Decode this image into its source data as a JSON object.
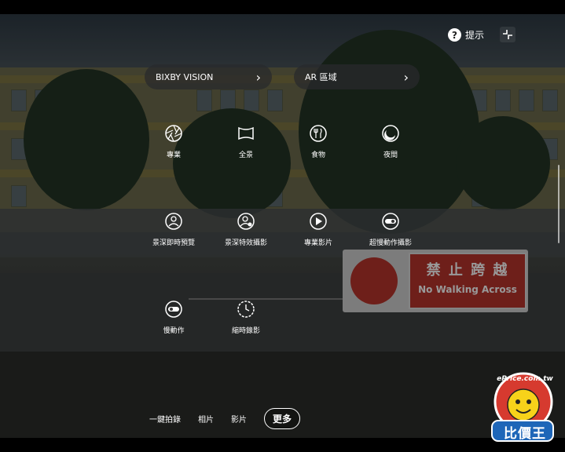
{
  "header": {
    "help_label": "提示"
  },
  "pills": [
    {
      "label": "BIXBY VISION",
      "chevron": "›"
    },
    {
      "label": "AR 區域",
      "chevron": "›"
    }
  ],
  "modes": [
    {
      "label": "專業",
      "icon": "aperture-icon"
    },
    {
      "label": "全景",
      "icon": "panorama-icon"
    },
    {
      "label": "食物",
      "icon": "food-icon"
    },
    {
      "label": "夜間",
      "icon": "night-moon-icon"
    },
    {
      "label": "景深即時預覽",
      "icon": "portrait-live-focus-icon"
    },
    {
      "label": "景深特效攝影",
      "icon": "portrait-effect-icon"
    },
    {
      "label": "專業影片",
      "icon": "pro-video-play-icon"
    },
    {
      "label": "超慢動作攝影",
      "icon": "super-slow-motion-icon"
    },
    {
      "label": "慢動作",
      "icon": "slow-motion-icon"
    },
    {
      "label": "縮時錄影",
      "icon": "hyperlapse-timer-icon"
    }
  ],
  "bottom": {
    "items": [
      "一鍵拍錄",
      "相片",
      "影片"
    ],
    "more_label": "更多"
  },
  "scene": {
    "sign_cn": "禁 止 跨 越",
    "sign_en": "No Walking Across"
  },
  "watermark": {
    "brand": "ePrice.com.tw",
    "name": "比價王"
  },
  "colors": {
    "sign_red": "#b8342c",
    "logo_red": "#d63a2f",
    "logo_yellow": "#f7d21a"
  }
}
